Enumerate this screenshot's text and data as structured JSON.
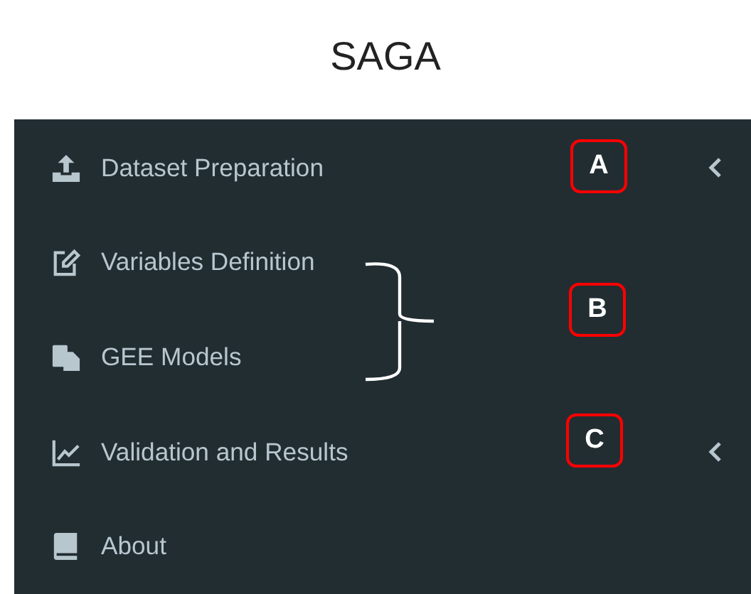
{
  "title": "SAGA",
  "menu": [
    {
      "label": "Dataset Preparation",
      "kind": "upload",
      "expandable": true
    },
    {
      "label": "Variables Definition",
      "kind": "edit",
      "expandable": false
    },
    {
      "label": "GEE Models",
      "kind": "clipboard",
      "expandable": false
    },
    {
      "label": "Validation and Results",
      "kind": "chart",
      "expandable": true
    },
    {
      "label": "About",
      "kind": "book",
      "expandable": false
    }
  ],
  "callouts": [
    {
      "label": "A",
      "kind": "single"
    },
    {
      "label": "B",
      "kind": "brace"
    },
    {
      "label": "C",
      "kind": "single"
    }
  ]
}
